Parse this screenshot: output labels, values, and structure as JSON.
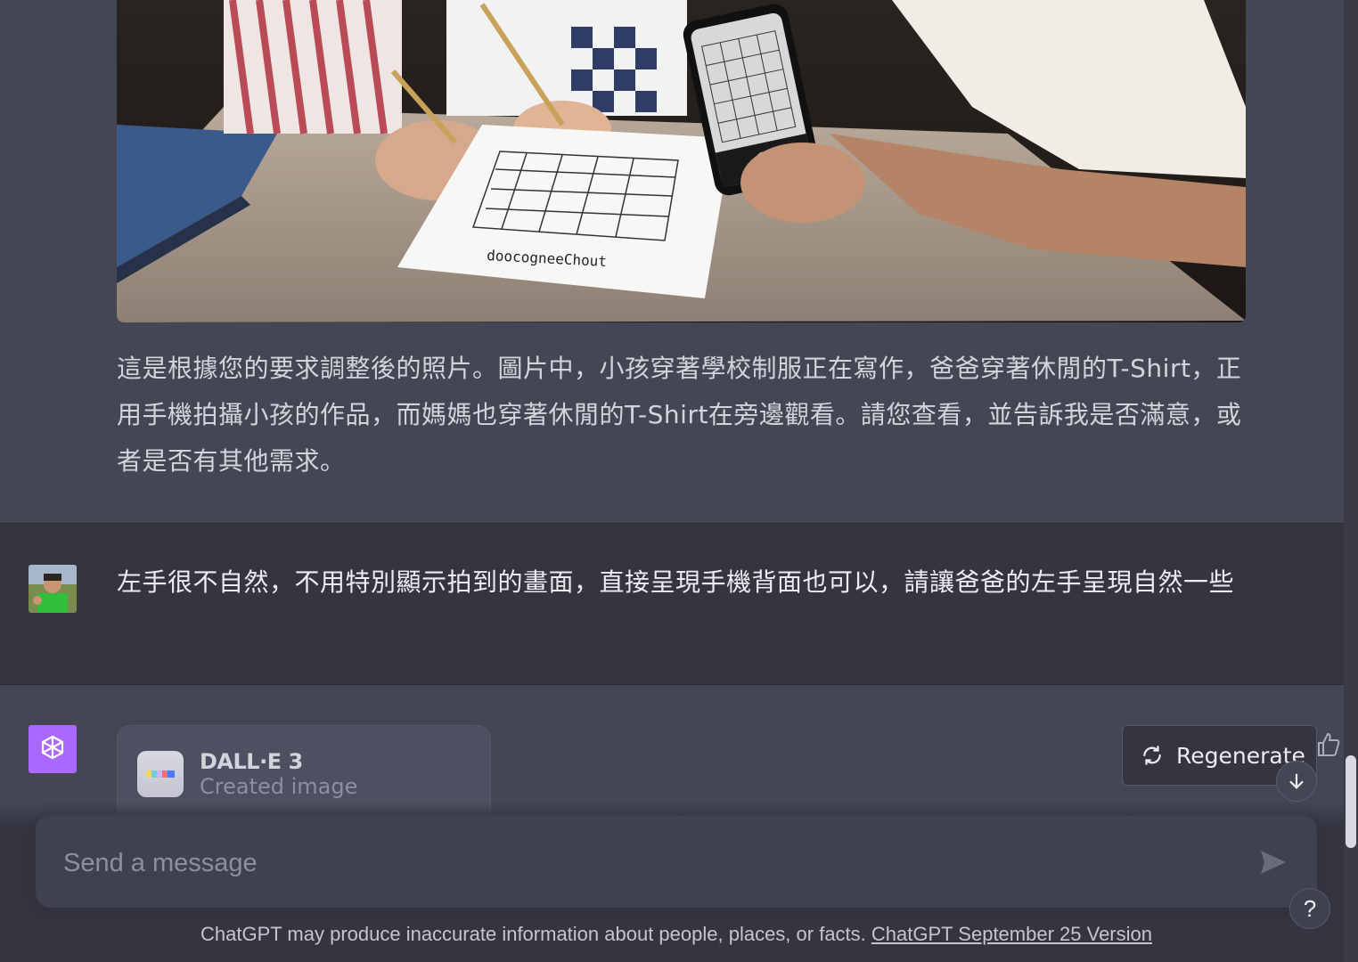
{
  "conversation": {
    "assistant_reply": "這是根據您的要求調整後的照片。圖片中，小孩穿著學校制服正在寫作，爸爸穿著休閒的T-Shirt，正用手機拍攝小孩的作品，而媽媽也穿著休閒的T-Shirt在旁邊觀看。請您查看，並告訴我是否滿意，或者是否有其他需求。",
    "image_caption_text": "doocogneeChout",
    "user_message": "左手很不自然，不用特別顯示拍到的畫面，直接呈現手機背面也可以，請讓爸爸的左手呈現自然一些",
    "tool_card": {
      "title": "DALL·E 3",
      "subtitle": "Created image"
    }
  },
  "controls": {
    "regenerate_label": "Regenerate",
    "help_label": "?"
  },
  "composer": {
    "placeholder": "Send a message"
  },
  "footer": {
    "disclaimer": "ChatGPT may produce inaccurate information about people, places, or facts. ",
    "version_link": "ChatGPT September 25 Version"
  },
  "colors": {
    "assistant_bg": "#444654",
    "user_bg": "#343541",
    "gpt_avatar": "#ab68ff"
  }
}
